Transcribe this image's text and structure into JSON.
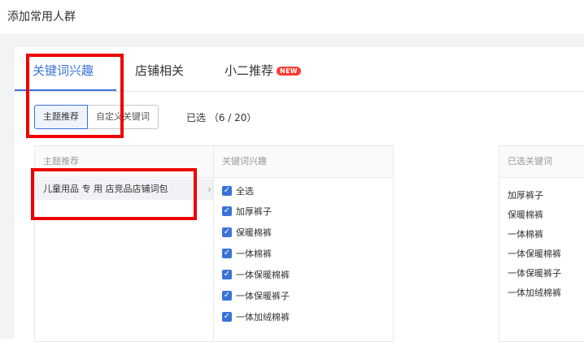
{
  "page": {
    "title": "添加常用人群"
  },
  "tabs": [
    {
      "label": "关键词兴趣"
    },
    {
      "label": "店铺相关"
    },
    {
      "label": "小二推荐",
      "badge": "NEW"
    }
  ],
  "segments": {
    "theme": "主题推荐",
    "custom": "自定义关键词"
  },
  "selected_count": "已选 （6 / 20）",
  "theme_panel": {
    "header": "主题推荐",
    "item": "儿童用品 专 用 店竞品店铺词包",
    "chevron": "›"
  },
  "keyword_panel": {
    "header": "关键词兴趣",
    "items": [
      "全选",
      "加厚裤子",
      "保暖棉裤",
      "一体棉裤",
      "一体保暖棉裤",
      "一体保暖裤子",
      "一体加绒棉裤"
    ]
  },
  "selected_panel": {
    "header": "已选关键词",
    "items": [
      "加厚裤子",
      "保暖棉裤",
      "一体棉裤",
      "一体保暖棉裤",
      "一体保暖裤子",
      "一体加绒棉裤"
    ]
  },
  "colors": {
    "accent": "#3a72d8",
    "annotation": "#ee0000",
    "badge": "#ff3b30"
  }
}
